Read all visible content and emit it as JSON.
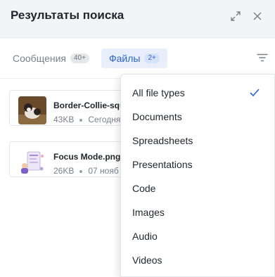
{
  "header": {
    "title": "Результаты поиска",
    "expand_icon": "expand-icon",
    "close_icon": "close-icon"
  },
  "tabs": [
    {
      "label": "Сообщения",
      "badge": "40+",
      "active": false
    },
    {
      "label": "Файлы",
      "badge": "2+",
      "active": true
    }
  ],
  "filter_icon": "filter-icon",
  "files": [
    {
      "name": "Border-Collie-squ",
      "size": "43KB",
      "date": "Сегодня"
    },
    {
      "name": "Focus Mode.png",
      "size": "26KB",
      "date": "07 нояб"
    }
  ],
  "file_type_menu": {
    "items": [
      {
        "label": "All file types",
        "selected": true
      },
      {
        "label": "Documents",
        "selected": false
      },
      {
        "label": "Spreadsheets",
        "selected": false
      },
      {
        "label": "Presentations",
        "selected": false
      },
      {
        "label": "Code",
        "selected": false
      },
      {
        "label": "Images",
        "selected": false
      },
      {
        "label": "Audio",
        "selected": false
      },
      {
        "label": "Videos",
        "selected": false
      }
    ]
  },
  "colors": {
    "accent": "#2d63c8",
    "active_tab_bg": "#e8effb",
    "header_bg": "#f3f4f6"
  }
}
